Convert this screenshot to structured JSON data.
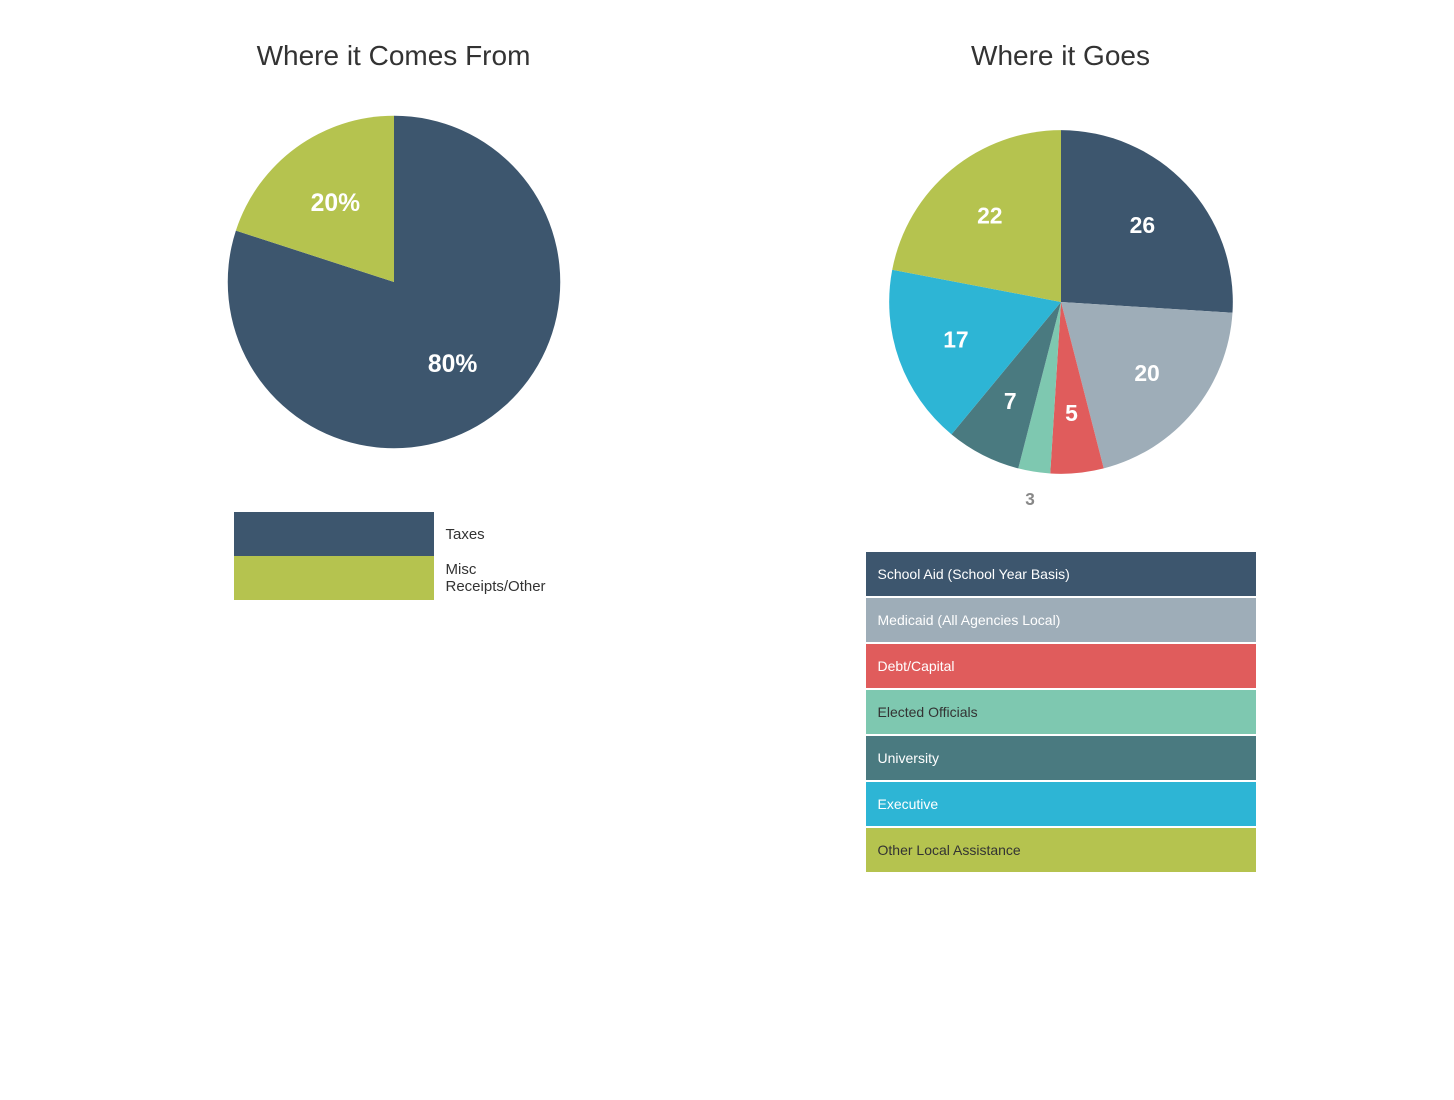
{
  "left_chart": {
    "title": "Where it Comes From",
    "segments": [
      {
        "label": "Taxes",
        "value": 80,
        "color": "#3d566e",
        "text_color": "white"
      },
      {
        "label": "Misc Receipts/Other",
        "value": 20,
        "color": "#b5c34f",
        "text_color": "white"
      }
    ],
    "legend": [
      {
        "label": "Taxes",
        "color": "#3d566e"
      },
      {
        "label": "Misc Receipts/Other",
        "color": "#b5c34f"
      }
    ]
  },
  "right_chart": {
    "title": "Where it Goes",
    "segments": [
      {
        "label": "School Aid (School Year Basis)",
        "value": 26,
        "color": "#3d566e"
      },
      {
        "label": "Medicaid (All Agencies Local)",
        "value": 20,
        "color": "#9eadb8"
      },
      {
        "label": "Debt/Capital",
        "value": 5,
        "color": "#e05c5c"
      },
      {
        "label": "Elected Officials",
        "value": 3,
        "color": "#7ec8b0"
      },
      {
        "label": "University",
        "value": 7,
        "color": "#4a7a80"
      },
      {
        "label": "Executive",
        "value": 17,
        "color": "#2db5d5"
      },
      {
        "label": "Other Local Assistance",
        "value": 22,
        "color": "#b5c34f"
      }
    ],
    "legend": [
      {
        "label": "School Aid (School Year Basis)",
        "color": "#3d566e",
        "text_color": "white"
      },
      {
        "label": "Medicaid (All Agencies Local)",
        "color": "#9eadb8",
        "text_color": "white"
      },
      {
        "label": "Debt/Capital",
        "color": "#e05c5c",
        "text_color": "white"
      },
      {
        "label": "Elected Officials",
        "color": "#7ec8b0",
        "text_color": "dark"
      },
      {
        "label": "University",
        "color": "#4a7a80",
        "text_color": "white"
      },
      {
        "label": "Executive",
        "color": "#2db5d5",
        "text_color": "white"
      },
      {
        "label": "Other Local Assistance",
        "color": "#b5c34f",
        "text_color": "dark"
      }
    ]
  }
}
